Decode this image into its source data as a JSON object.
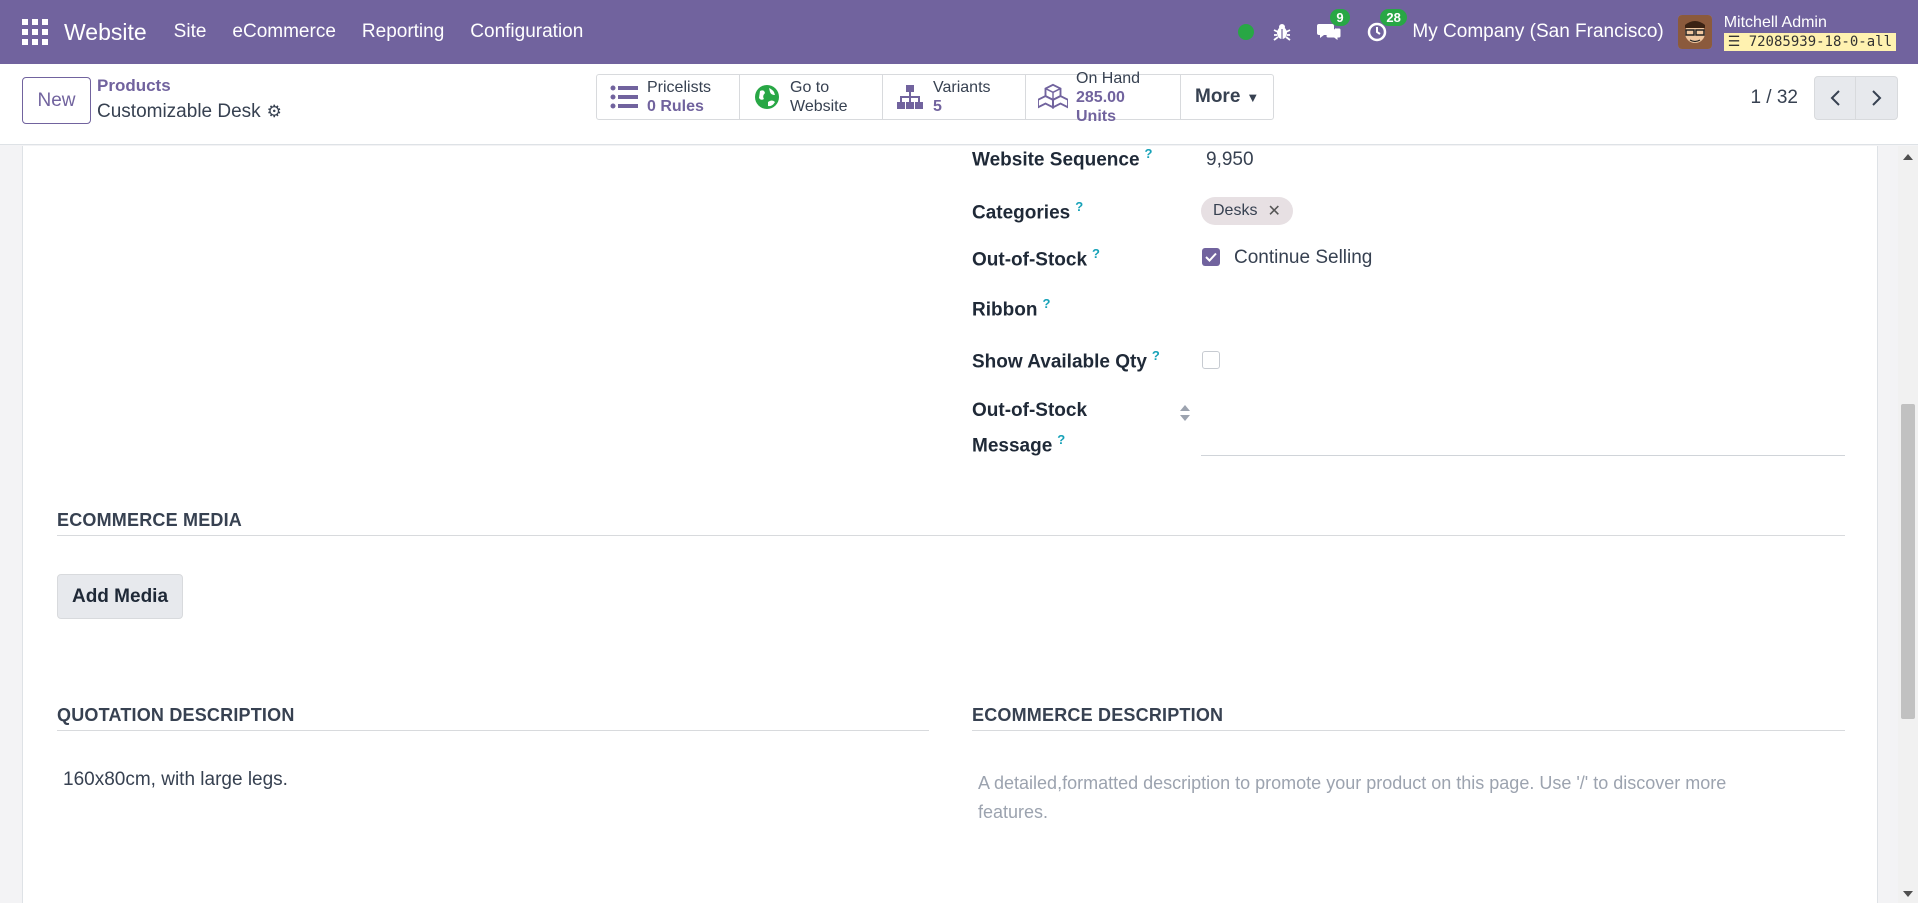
{
  "navbar": {
    "brand": "Website",
    "menu": [
      "Site",
      "eCommerce",
      "Reporting",
      "Configuration"
    ],
    "chat_count": "9",
    "activity_count": "28",
    "company": "My Company (San Francisco)",
    "user_name": "Mitchell Admin",
    "db_name": "72085939-18-0-all"
  },
  "control": {
    "new_label": "New",
    "breadcrumb_parent": "Products",
    "breadcrumb_current": "Customizable Desk",
    "smart_buttons": [
      {
        "label": "Pricelists",
        "value": "0 Rules",
        "icon": "list-icon"
      },
      {
        "label": "Go to",
        "value": "Website",
        "icon": "globe-icon"
      },
      {
        "label": "Variants",
        "value": "5",
        "icon": "sitemap-icon"
      },
      {
        "label": "On Hand",
        "value": "285.00 Units",
        "icon": "cubes-icon"
      }
    ],
    "more_label": "More",
    "pager": "1 / 32"
  },
  "form": {
    "website_sequence_label": "Website Sequence",
    "website_sequence_value": "9,950",
    "categories_label": "Categories",
    "category_tag": "Desks",
    "out_of_stock_label": "Out-of-Stock",
    "continue_selling_label": "Continue Selling",
    "ribbon_label": "Ribbon",
    "show_qty_label": "Show Available Qty",
    "oos_message_label_1": "Out-of-Stock",
    "oos_message_label_2": "Message",
    "ecommerce_media_title": "ECOMMERCE MEDIA",
    "add_media_label": "Add Media",
    "quotation_title": "QUOTATION DESCRIPTION",
    "quotation_text": "160x80cm, with large legs.",
    "ecommerce_desc_title": "ECOMMERCE DESCRIPTION",
    "ecommerce_desc_placeholder": "A detailed,formatted description to promote your product on this page. Use '/' to discover more features."
  },
  "colors": {
    "brand": "#71639e",
    "badge": "#28a745"
  }
}
